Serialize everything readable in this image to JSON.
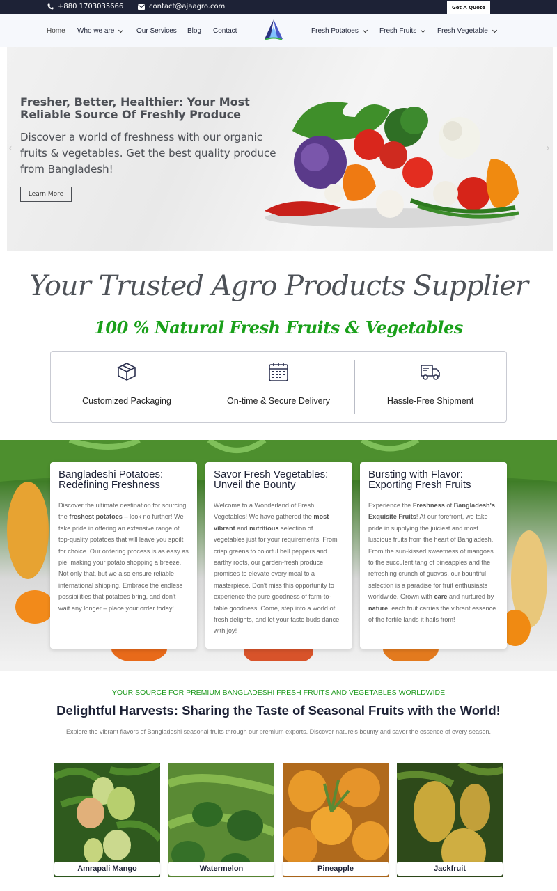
{
  "topbar": {
    "phone": "+880 1703035666",
    "email": "contact@ajaagro.com",
    "quote_label": "Get A Quote"
  },
  "nav": {
    "items": [
      {
        "label": "Home",
        "dropdown": false
      },
      {
        "label": "Who we are",
        "dropdown": true
      },
      {
        "label": "Our Services",
        "dropdown": false
      },
      {
        "label": "Blog",
        "dropdown": false
      },
      {
        "label": "Contact",
        "dropdown": false
      },
      {
        "label": "Fresh Potatoes",
        "dropdown": true
      },
      {
        "label": "Fresh Fruits",
        "dropdown": true
      },
      {
        "label": "Fresh Vegetable",
        "dropdown": true
      }
    ]
  },
  "hero": {
    "title": "Fresher, Better, Healthier: Your Most Reliable Source Of Freshly Produce",
    "subtitle": "Discover a world of freshness with our organic fruits & vegetables. Get the best quality produce from Bangladesh!",
    "button": "Learn More",
    "prev": "‹",
    "next": "›"
  },
  "trusted": {
    "title": "Your Trusted Agro Products Supplier",
    "subtitle": "100 % Natural Fresh Fruits & Vegetables",
    "features": [
      {
        "icon": "box-icon",
        "label": "Customized Packaging"
      },
      {
        "icon": "calendar-icon",
        "label": "On-time & Secure Delivery"
      },
      {
        "icon": "truck-icon",
        "label": "Hassle-Free Shipment"
      }
    ]
  },
  "cards": [
    {
      "title": "Bangladeshi Potatoes: Redefining Freshness",
      "parts": [
        "Discover the ultimate destination for sourcing the ",
        "freshest potatoes",
        " – look no further! We take pride in offering an extensive range of top-quality potatoes that will leave you spoilt for choice. Our ordering process is as easy as pie, making your potato shopping a breeze. Not only that, but we also ensure reliable international shipping. Embrace the endless possibilities that potatoes bring, and don't wait any longer – place your order today!"
      ]
    },
    {
      "title": "Savor Fresh Vegetables: Unveil the Bounty",
      "parts": [
        "Welcome to a Wonderland of Fresh Vegetables! We have gathered the ",
        "most vibrant",
        " and ",
        "nutritious",
        " selection of vegetables just for your requirements. From crisp greens to colorful bell peppers and earthy roots, our garden-fresh produce promises to elevate every meal to a masterpiece. Don't miss this opportunity to experience the pure goodness of farm-to-table goodness. Come, step into a world of fresh delights, and let your taste buds dance with joy!"
      ]
    },
    {
      "title": "Bursting with Flavor: Exporting Fresh Fruits",
      "parts": [
        "Experience the ",
        "Freshness",
        " of ",
        "Bangladesh's Exquisite Fruits",
        "! At our forefront, we take pride in supplying the juiciest and most luscious fruits from the heart of Bangladesh. From the sun-kissed sweetness of mangoes to the succulent tang of pineapples and the refreshing crunch of guavas, our bountiful selection is a paradise for fruit enthusiasts worldwide. Grown with ",
        "care",
        " and nurtured by ",
        "nature",
        ", each fruit carries the vibrant essence of the fertile lands it hails from!"
      ]
    }
  ],
  "seasonal": {
    "eyebrow": "YOUR SOURCE FOR PREMIUM BANGLADESHI FRESH FRUITS AND VEGETABLES WORLDWIDE",
    "title": "Delightful Harvests: Sharing the Taste of Seasonal Fruits with the World!",
    "description": "Explore the vibrant flavors of Bangladeshi seasonal fruits through our premium exports. Discover nature's bounty and savor the essence of every season.",
    "fruits": [
      {
        "name": "Amrapali Mango"
      },
      {
        "name": "Watermelon"
      },
      {
        "name": "Pineapple"
      },
      {
        "name": "Jackfruit"
      }
    ]
  },
  "colors": {
    "navy": "#1d2236",
    "green": "#1f9a1f"
  }
}
